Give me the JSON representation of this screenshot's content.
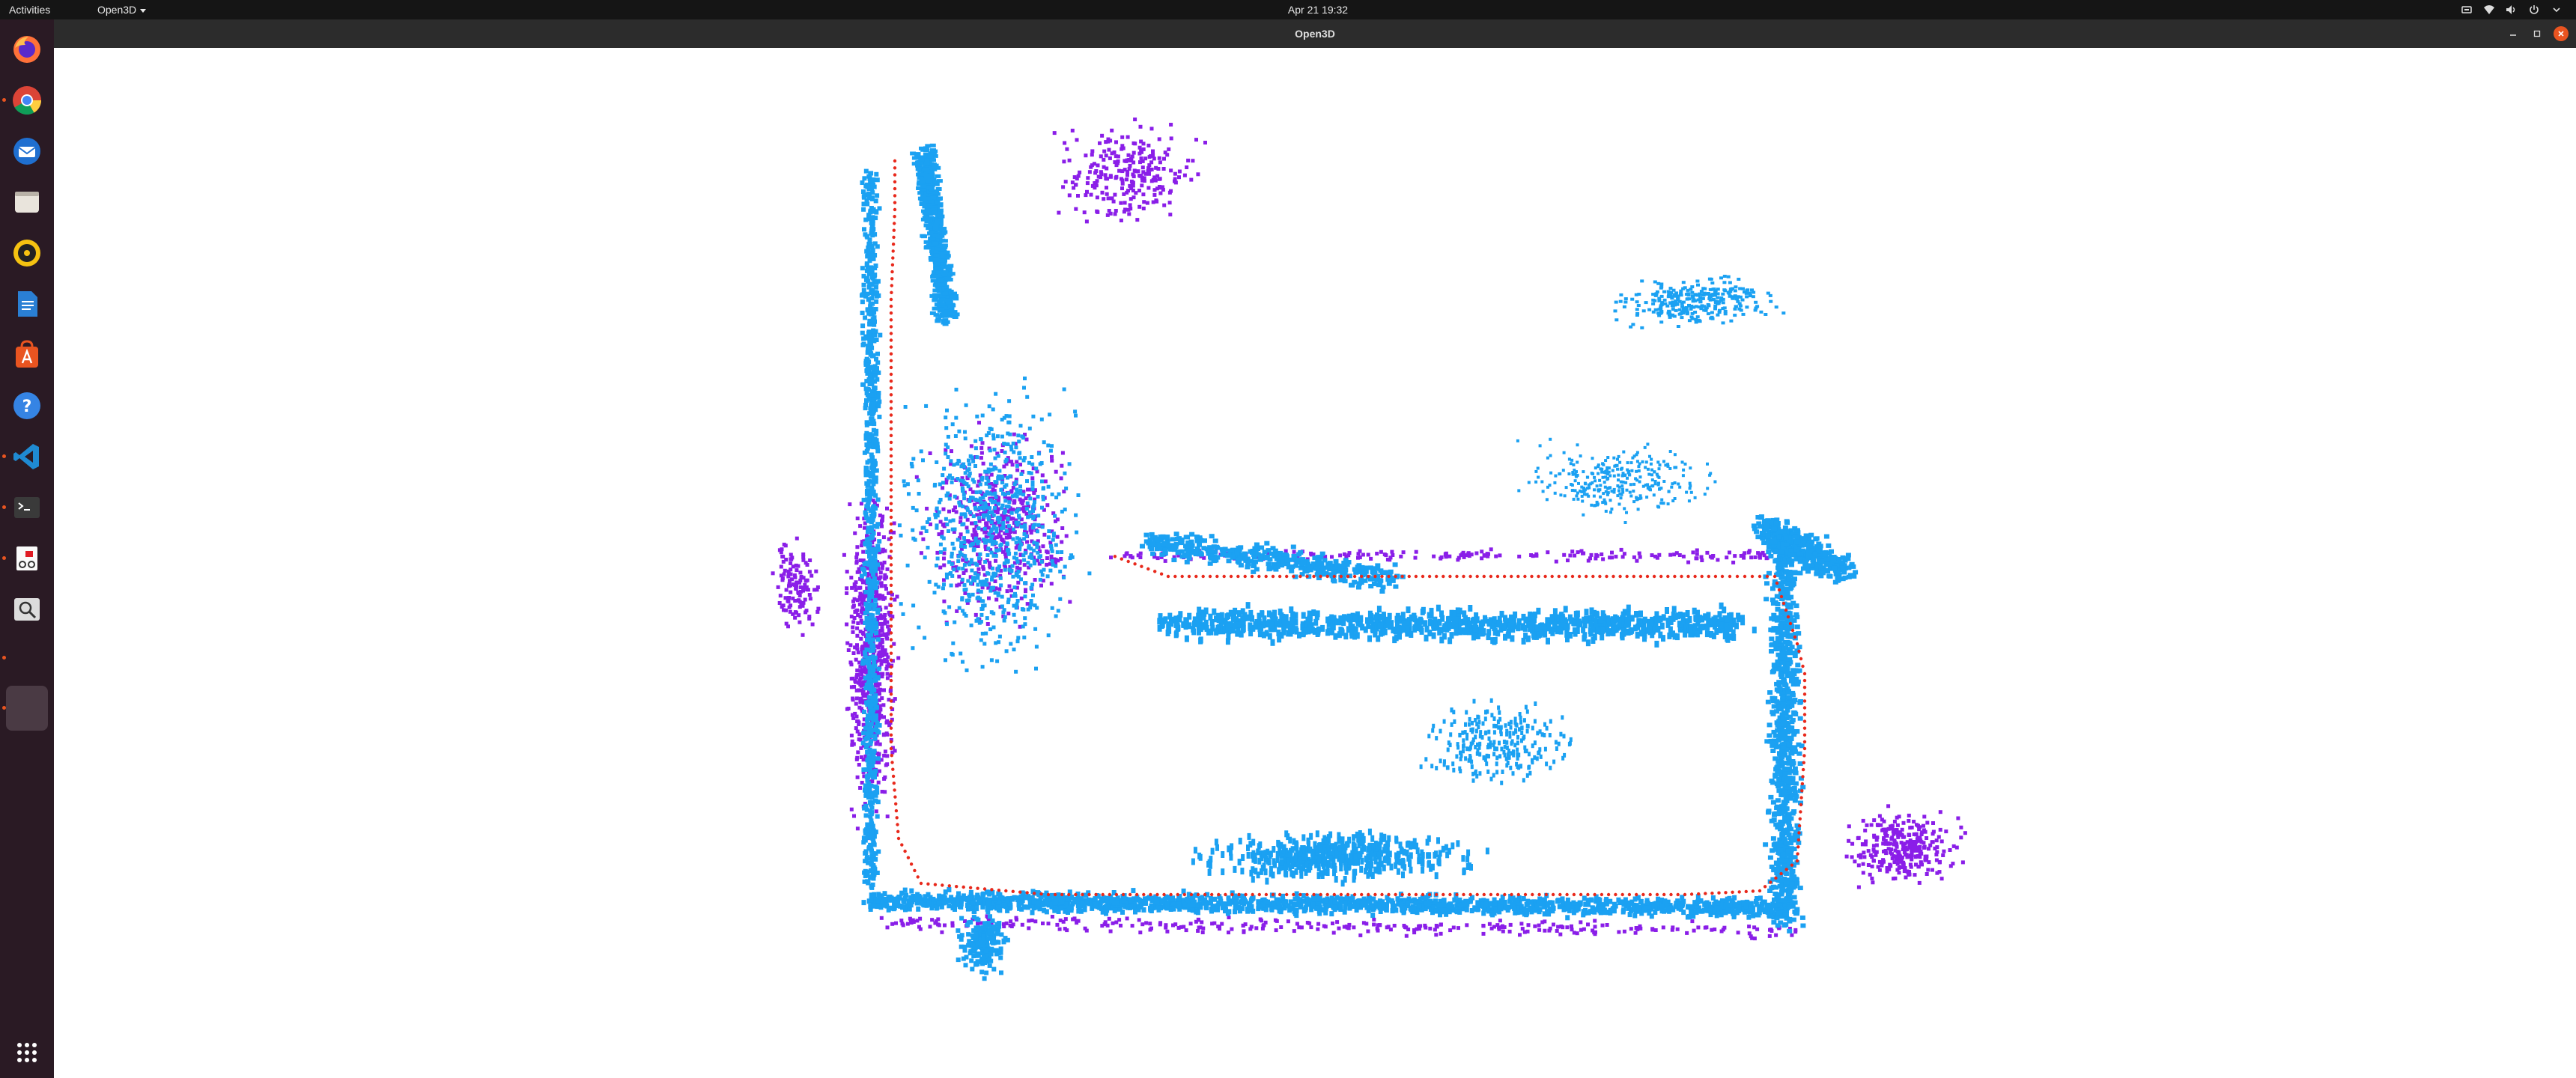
{
  "topbar": {
    "activities_label": "Activities",
    "app_menu_label": "Open3D",
    "clock": "Apr 21  19:32",
    "tray_icons": [
      "network-icon",
      "wifi-icon",
      "volume-icon",
      "power-icon",
      "chevron-down-icon"
    ]
  },
  "window": {
    "title": "Open3D",
    "controls": [
      "minimize-icon",
      "maximize-icon",
      "close-icon"
    ]
  },
  "dock": {
    "items": [
      {
        "name": "firefox-icon",
        "running": false
      },
      {
        "name": "chrome-icon",
        "running": true
      },
      {
        "name": "thunderbird-icon",
        "running": false
      },
      {
        "name": "files-icon",
        "running": false
      },
      {
        "name": "rhythmbox-icon",
        "running": false
      },
      {
        "name": "writer-icon",
        "running": false
      },
      {
        "name": "app-center-icon",
        "running": false
      },
      {
        "name": "help-icon",
        "running": false
      },
      {
        "name": "vscode-icon",
        "running": true
      },
      {
        "name": "terminal-icon",
        "running": true
      },
      {
        "name": "document-viewer-icon",
        "running": true
      },
      {
        "name": "image-viewer-icon",
        "running": false
      },
      {
        "name": "blank-app-icon",
        "running": true
      },
      {
        "name": "open3d-window-icon",
        "running": true,
        "active": true
      },
      {
        "name": "show-apps-icon",
        "running": false
      }
    ]
  },
  "point_cloud": {
    "colors": {
      "cyan": "#1ba1f2",
      "purple": "#8a1ee8",
      "trajectory": "#e8291c"
    }
  },
  "colors": {
    "topbar_bg": "#151515",
    "titlebar_bg": "#2c2c2c",
    "dock_bg": "#2a1a24",
    "accent": "#e95420"
  }
}
